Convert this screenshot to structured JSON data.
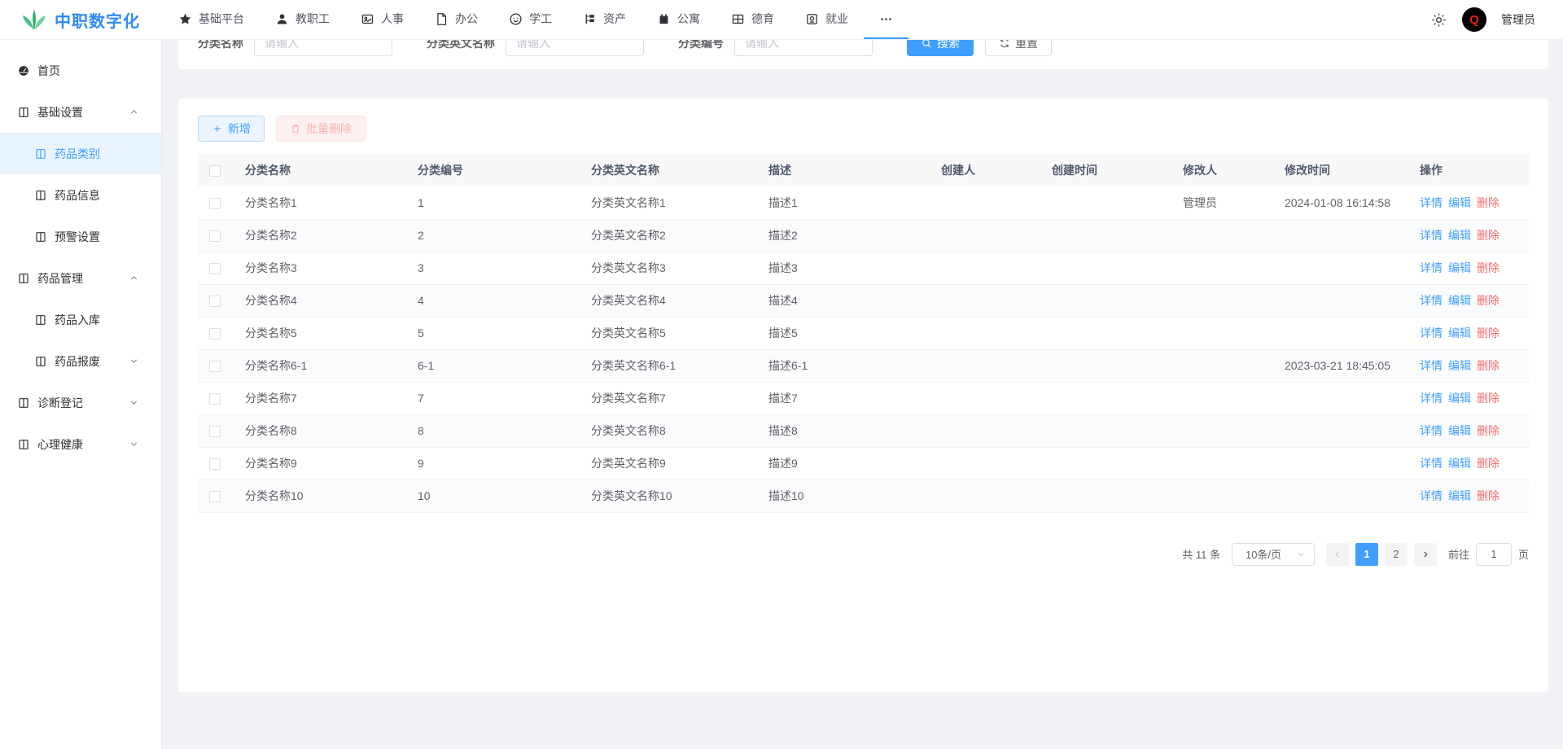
{
  "brand": {
    "name": "中职数字化"
  },
  "navbar": {
    "items": [
      {
        "label": "基础平台",
        "icon": "star",
        "active": false
      },
      {
        "label": "教职工",
        "icon": "teacher",
        "active": false
      },
      {
        "label": "人事",
        "icon": "portrait",
        "active": false
      },
      {
        "label": "办公",
        "icon": "doc",
        "active": false
      },
      {
        "label": "学工",
        "icon": "student",
        "active": false
      },
      {
        "label": "资产",
        "icon": "asset",
        "active": false
      },
      {
        "label": "公寓",
        "icon": "apartment",
        "active": false
      },
      {
        "label": "德育",
        "icon": "grid",
        "active": false
      },
      {
        "label": "就业",
        "icon": "job",
        "active": false
      },
      {
        "label": "",
        "icon": "dots",
        "active": true
      }
    ],
    "user": {
      "name": "管理员",
      "avatar_letter": "Q"
    }
  },
  "sidebar": {
    "items": [
      {
        "label": "首页",
        "icon": "dashboard",
        "level": 0,
        "chevron": null,
        "active": false
      },
      {
        "label": "基础设置",
        "icon": "book",
        "level": 0,
        "chevron": "up",
        "active": false
      },
      {
        "label": "药品类别",
        "icon": "book",
        "level": 1,
        "chevron": null,
        "active": true
      },
      {
        "label": "药品信息",
        "icon": "book",
        "level": 1,
        "chevron": null,
        "active": false
      },
      {
        "label": "预警设置",
        "icon": "book",
        "level": 1,
        "chevron": null,
        "active": false
      },
      {
        "label": "药品管理",
        "icon": "book",
        "level": 0,
        "chevron": "up",
        "active": false
      },
      {
        "label": "药品入库",
        "icon": "book",
        "level": 1,
        "chevron": null,
        "active": false
      },
      {
        "label": "药品报废",
        "icon": "book",
        "level": 1,
        "chevron": "down",
        "active": false
      },
      {
        "label": "诊断登记",
        "icon": "book",
        "level": 0,
        "chevron": "down",
        "active": false
      },
      {
        "label": "心理健康",
        "icon": "book",
        "level": 0,
        "chevron": "down",
        "active": false
      }
    ]
  },
  "search": {
    "fields": [
      {
        "label": "分类名称",
        "placeholder": "请输入"
      },
      {
        "label": "分类英文名称",
        "placeholder": "请输入"
      },
      {
        "label": "分类编号",
        "placeholder": "请输入"
      }
    ],
    "search_label": "搜索",
    "reset_label": "重置"
  },
  "toolbar": {
    "add_label": "新增",
    "batch_delete_label": "批量删除"
  },
  "table": {
    "columns": [
      "分类名称",
      "分类编号",
      "分类英文名称",
      "描述",
      "创建人",
      "创建时间",
      "修改人",
      "修改时间",
      "操作"
    ],
    "row_actions": [
      "详情",
      "编辑",
      "删除"
    ],
    "rows": [
      {
        "name": "分类名称1",
        "code": "1",
        "en_name": "分类英文名称1",
        "desc": "描述1",
        "creator": "",
        "create_time": "",
        "modifier": "管理员",
        "modify_time": "2024-01-08 16:14:58"
      },
      {
        "name": "分类名称2",
        "code": "2",
        "en_name": "分类英文名称2",
        "desc": "描述2",
        "creator": "",
        "create_time": "",
        "modifier": "",
        "modify_time": ""
      },
      {
        "name": "分类名称3",
        "code": "3",
        "en_name": "分类英文名称3",
        "desc": "描述3",
        "creator": "",
        "create_time": "",
        "modifier": "",
        "modify_time": ""
      },
      {
        "name": "分类名称4",
        "code": "4",
        "en_name": "分类英文名称4",
        "desc": "描述4",
        "creator": "",
        "create_time": "",
        "modifier": "",
        "modify_time": ""
      },
      {
        "name": "分类名称5",
        "code": "5",
        "en_name": "分类英文名称5",
        "desc": "描述5",
        "creator": "",
        "create_time": "",
        "modifier": "",
        "modify_time": ""
      },
      {
        "name": "分类名称6-1",
        "code": "6-1",
        "en_name": "分类英文名称6-1",
        "desc": "描述6-1",
        "creator": "",
        "create_time": "",
        "modifier": "",
        "modify_time": "2023-03-21 18:45:05"
      },
      {
        "name": "分类名称7",
        "code": "7",
        "en_name": "分类英文名称7",
        "desc": "描述7",
        "creator": "",
        "create_time": "",
        "modifier": "",
        "modify_time": ""
      },
      {
        "name": "分类名称8",
        "code": "8",
        "en_name": "分类英文名称8",
        "desc": "描述8",
        "creator": "",
        "create_time": "",
        "modifier": "",
        "modify_time": ""
      },
      {
        "name": "分类名称9",
        "code": "9",
        "en_name": "分类英文名称9",
        "desc": "描述9",
        "creator": "",
        "create_time": "",
        "modifier": "",
        "modify_time": ""
      },
      {
        "name": "分类名称10",
        "code": "10",
        "en_name": "分类英文名称10",
        "desc": "描述10",
        "creator": "",
        "create_time": "",
        "modifier": "",
        "modify_time": ""
      }
    ]
  },
  "pagination": {
    "total_label": "共 11 条",
    "size_label": "10条/页",
    "pages": [
      "1",
      "2"
    ],
    "active_page": "1",
    "goto_label": "前往",
    "goto_value": "1",
    "unit_label": "页"
  },
  "colors": {
    "primary": "#409eff",
    "danger": "#f56c6c",
    "brand_blue": "#2e8bf0",
    "brand_green": "#3eb97d"
  }
}
